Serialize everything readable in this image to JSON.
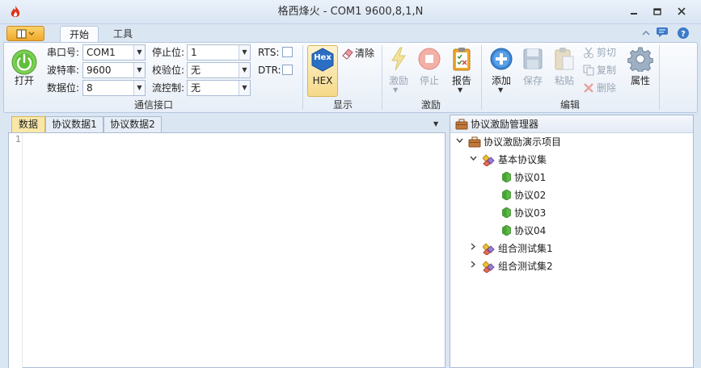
{
  "window": {
    "title": "格西烽火 - COM1  9600,8,1,N",
    "controls": [
      "minimize",
      "restore",
      "close"
    ]
  },
  "ribbon_tabs": [
    {
      "label": "开始",
      "active": true
    },
    {
      "label": "工具",
      "active": false
    }
  ],
  "comm_group": {
    "label": "通信接口",
    "open_button": "打开",
    "port_label": "串口号:",
    "port_value": "COM1",
    "baud_label": "波特率:",
    "baud_value": "9600",
    "databits_label": "数据位:",
    "databits_value": "8",
    "stopbits_label": "停止位:",
    "stopbits_value": "1",
    "parity_label": "校验位:",
    "parity_value": "无",
    "flow_label": "流控制:",
    "flow_value": "无",
    "rts_label": "RTS:",
    "dtr_label": "DTR:",
    "rts_checked": false,
    "dtr_checked": false
  },
  "display_group": {
    "label": "显示",
    "hex_icon_text": "Hex",
    "hex_button": "HEX",
    "clear_button": "清除"
  },
  "stimulus_group": {
    "label": "激励",
    "stimulus_button": "激励",
    "stop_button": "停止",
    "report_button": "报告"
  },
  "edit_group": {
    "label": "编辑",
    "add_button": "添加",
    "save_button": "保存",
    "paste_button": "粘贴",
    "cut_button": "剪切",
    "copy_button": "复制",
    "delete_button": "删除",
    "properties_button": "属性"
  },
  "doc_tabs": [
    "数据",
    "协议数据1",
    "协议数据2"
  ],
  "editor": {
    "line_numbers": [
      "1"
    ]
  },
  "tree": {
    "header": "协议激励管理器",
    "project": "协议激励演示项目",
    "sets": [
      {
        "label": "基本协议集",
        "expanded": true,
        "children": [
          "协议01",
          "协议02",
          "协议03",
          "协议04"
        ]
      },
      {
        "label": "组合测试集1",
        "expanded": false,
        "children": []
      },
      {
        "label": "组合测试集2",
        "expanded": false,
        "children": []
      }
    ]
  },
  "colors": {
    "accent_orange": "#f0a82a",
    "power_green": "#5fbf3a",
    "hex_blue": "#2a6fc4",
    "stop_red": "#e0563f",
    "tab_active": "#f9e7a8"
  }
}
